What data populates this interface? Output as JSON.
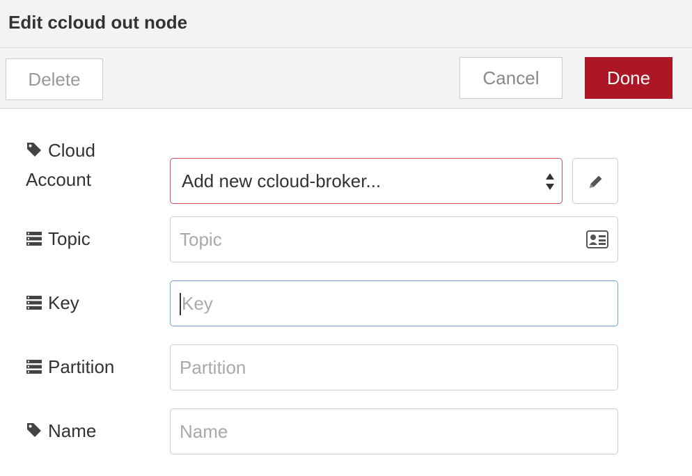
{
  "dialog": {
    "title": "Edit ccloud out node"
  },
  "toolbar": {
    "delete_label": "Delete",
    "cancel_label": "Cancel",
    "done_label": "Done"
  },
  "colors": {
    "primary": "#ad1625",
    "invalid_border": "#d6485a",
    "focus_border": "#6fa4e0"
  },
  "form": {
    "cloud_account": {
      "label_line1": "Cloud",
      "label_line2": "Account",
      "icon": "tag-icon",
      "selected": "Add new ccloud-broker..."
    },
    "topic": {
      "label": "Topic",
      "icon": "list-icon",
      "placeholder": "Topic",
      "type_icon": "id-card-icon"
    },
    "key": {
      "label": "Key",
      "icon": "list-icon",
      "placeholder": "Key"
    },
    "partition": {
      "label": "Partition",
      "icon": "list-icon",
      "placeholder": "Partition"
    },
    "name": {
      "label": "Name",
      "icon": "tag-icon",
      "placeholder": "Name"
    }
  }
}
